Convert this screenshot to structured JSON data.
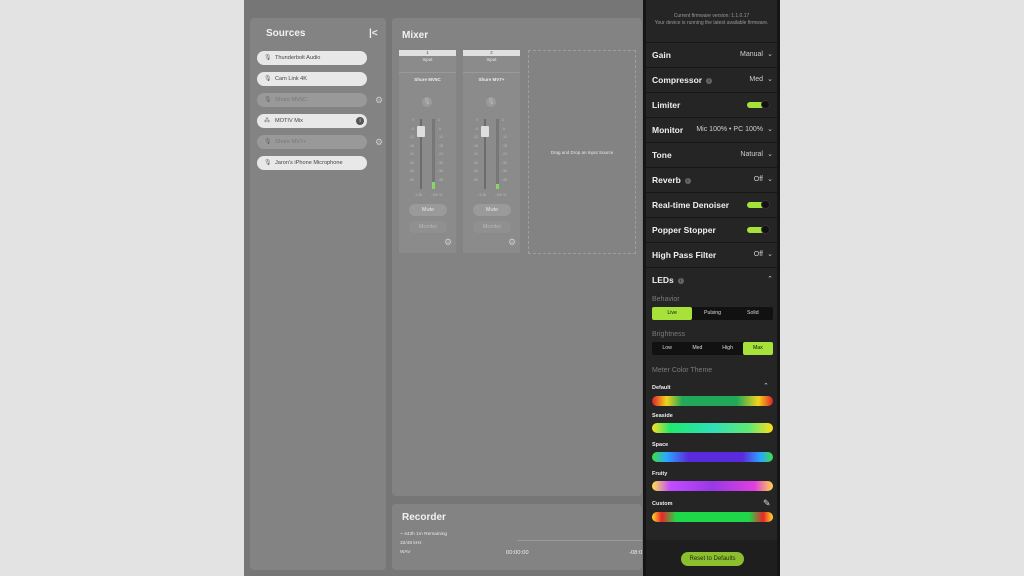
{
  "sources": {
    "title": "Sources",
    "items": [
      {
        "label": "Thunderbolt Audio",
        "dim": false,
        "icon": "mic-icon"
      },
      {
        "label": "Cam Link 4K",
        "dim": false,
        "icon": "mic-icon"
      },
      {
        "label": "Shure MV5C",
        "dim": true,
        "icon": "mic-icon"
      },
      {
        "label": "MOTIV Mix",
        "dim": false,
        "icon": "mix-icon"
      },
      {
        "label": "Shure MV7+",
        "dim": true,
        "icon": "mic-icon"
      },
      {
        "label": "Jaron's iPhone Microphone",
        "dim": false,
        "icon": "mic-icon"
      }
    ]
  },
  "mixer": {
    "title": "Mixer",
    "strips": [
      {
        "number": "1",
        "input": "Input",
        "name": "Shure MV5C",
        "level_left": "-1.48",
        "level_right": "-100 %",
        "mute": "Mute",
        "monitor": "Monitor"
      },
      {
        "number": "2",
        "input": "Input",
        "name": "Shure MV7+",
        "level_left": "-3.28",
        "level_right": "-100 %",
        "mute": "Mute",
        "monitor": "Monitor"
      }
    ],
    "scale_left": [
      "0",
      "-6",
      "-12",
      "-18",
      "-24",
      "-30",
      "-36",
      "-50"
    ],
    "scale_right": [
      "0",
      "-6",
      "-12",
      "-18",
      "-24",
      "-30",
      "-36",
      "-48"
    ],
    "drop_text": "Drag and Drop an Input Source"
  },
  "recorder": {
    "title": "Recorder",
    "remaining": "~ 443h 1m Remaining",
    "sample": "32/48 kHz",
    "format": "WAV",
    "time_elapsed": "00:00:00",
    "time_right": "-08:0"
  },
  "settings": {
    "firmware_line1": "Current firmware version: 1.1.0.17",
    "firmware_line2": "Your device is running the latest available firmware.",
    "rows": {
      "gain": {
        "label": "Gain",
        "value": "Manual"
      },
      "compressor": {
        "label": "Compressor",
        "value": "Med"
      },
      "limiter": {
        "label": "Limiter"
      },
      "monitor": {
        "label": "Monitor",
        "value": "Mic 100% • PC 100%"
      },
      "tone": {
        "label": "Tone",
        "value": "Natural"
      },
      "reverb": {
        "label": "Reverb",
        "value": "Off"
      },
      "denoiser": {
        "label": "Real-time Denoiser"
      },
      "popper": {
        "label": "Popper Stopper"
      },
      "highpass": {
        "label": "High Pass Filter",
        "value": "Off"
      },
      "leds": {
        "label": "LEDs"
      }
    },
    "behavior_label": "Behavior",
    "behavior_options": [
      "Live",
      "Pulsing",
      "Solid"
    ],
    "behavior_selected": "Live",
    "brightness_label": "Brightness",
    "brightness_options": [
      "Low",
      "Med",
      "High",
      "Max"
    ],
    "brightness_selected": "Max",
    "meter_label": "Meter Color Theme",
    "themes": [
      "Default",
      "Seaside",
      "Space",
      "Fruity",
      "Custom"
    ],
    "reset_label": "Reset to Defaults",
    "colors": {
      "accent": "#a6e23a"
    }
  }
}
